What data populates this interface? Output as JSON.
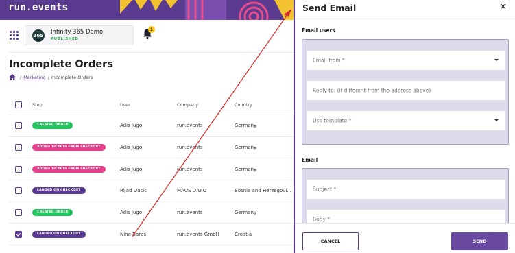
{
  "app": {
    "logo": "run.events",
    "event": {
      "badge": "365",
      "name": "Infinity 365 Demo",
      "status": "PUBLISHED"
    },
    "notifications_count": "1"
  },
  "page": {
    "title": "Incomplete Orders",
    "breadcrumb": {
      "link": "Marketing",
      "current": "Incomplete Orders"
    }
  },
  "table": {
    "headers": {
      "step": "Step",
      "user": "User",
      "company": "Company",
      "country": "Country"
    },
    "rows": [
      {
        "step": "CREATED ORDER",
        "step_color": "#22c55e",
        "user": "Adis Jugo",
        "company": "run.events",
        "country": "Germany",
        "checked": false
      },
      {
        "step": "ADDED TICKETS FROM CHECKOUT",
        "step_color": "#e83e8c",
        "user": "Adis Jugo",
        "company": "run.events",
        "country": "Germany",
        "checked": false
      },
      {
        "step": "ADDED TICKETS FROM CHECKOUT",
        "step_color": "#e83e8c",
        "user": "Adis Jugo",
        "company": "run.events",
        "country": "Germany",
        "checked": false
      },
      {
        "step": "LANDED ON CHECKOUT",
        "step_color": "#5a3b8f",
        "user": "Rijad Dacic",
        "company": "MAUS D.O.O",
        "country": "Bosnia and Herzegovi...",
        "checked": false
      },
      {
        "step": "CREATED ORDER",
        "step_color": "#22c55e",
        "user": "Adis Jugo",
        "company": "run.events",
        "country": "Germany",
        "checked": false
      },
      {
        "step": "LANDED ON CHECKOUT",
        "step_color": "#5a3b8f",
        "user": "Nina Baras",
        "company": "run.events GmbH",
        "country": "Croatia",
        "checked": true
      }
    ]
  },
  "modal": {
    "title": "Send Email",
    "email_users_label": "Email users",
    "email_from_placeholder": "Email from *",
    "reply_to_placeholder": "Reply to: (if different from the address above)",
    "template_placeholder": "Use template *",
    "email_label": "Email",
    "subject_placeholder": "Subject *",
    "body_placeholder": "Body *",
    "cancel_label": "CANCEL",
    "send_label": "SEND"
  },
  "colors": {
    "brand": "#5a3b8f",
    "annotation_arrow": "#d93030"
  }
}
